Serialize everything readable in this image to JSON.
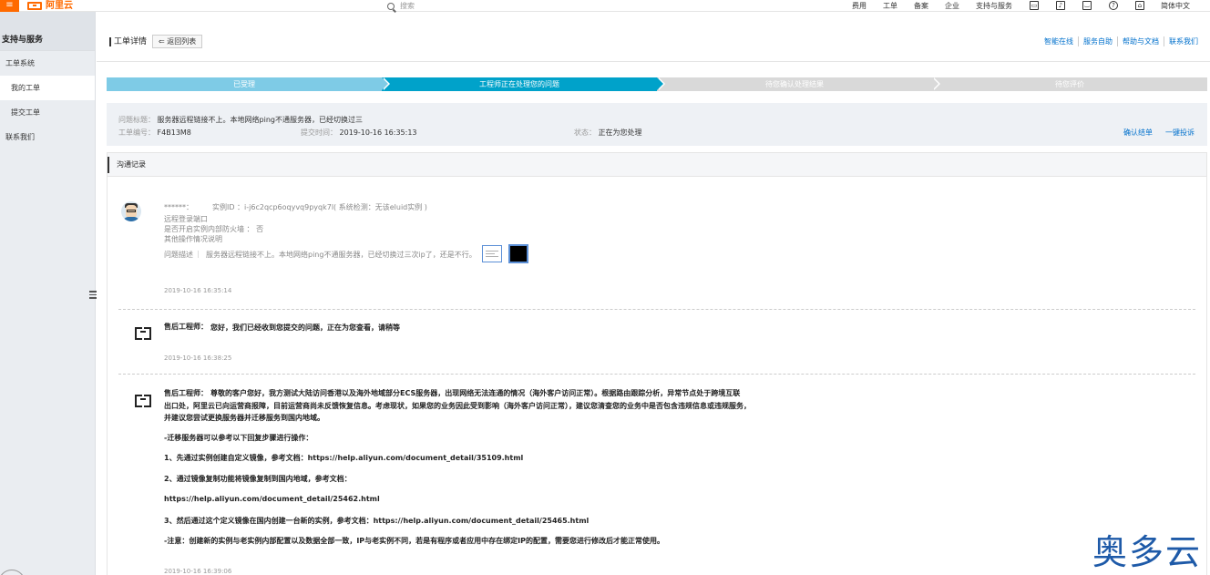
{
  "topbar": {
    "logo_text": "阿里云",
    "search_placeholder": "搜索",
    "nav": [
      "费用",
      "工单",
      "备案",
      "企业",
      "支持与服务"
    ],
    "icons": [
      "terminal-icon",
      "bell-icon",
      "cart-icon",
      "help-icon",
      "home-icon"
    ],
    "language": "简体中文",
    "accent": "#ff6a00"
  },
  "sidebar": {
    "title": "支持与服务",
    "items": [
      {
        "label": "工单系统",
        "level": 0,
        "active": false
      },
      {
        "label": "我的工单",
        "level": 1,
        "active": true
      },
      {
        "label": "提交工单",
        "level": 1,
        "active": false
      },
      {
        "label": "联系我们",
        "level": 0,
        "active": false
      }
    ]
  },
  "header": {
    "title": "工单详情",
    "back_label": "返回列表",
    "links": [
      "智能在线",
      "服务自助",
      "帮助与文档",
      "联系我们"
    ]
  },
  "steps": [
    {
      "label": "已受理",
      "state": "done"
    },
    {
      "label": "工程师正在处理您的问题",
      "state": "current"
    },
    {
      "label": "待您确认处理结果",
      "state": "todo"
    },
    {
      "label": "待您评价",
      "state": "todo"
    }
  ],
  "ticket": {
    "title_label": "问题标题：",
    "title": "服务器远程链接不上。本地网络ping不通服务器，已经切换过三",
    "id_label": "工单编号：",
    "id": "F4B13M8",
    "time_label": "提交时间：",
    "time": "2019-10-16 16:35:13",
    "status_label": "状态：",
    "status": "正在为您处理",
    "actions": [
      "确认结单",
      "一键投诉"
    ]
  },
  "comm": {
    "title": "沟通记录",
    "messages": [
      {
        "user": "******：",
        "instance": "实例ID ：i-j6c2qcp6oqyvq9pyqk7l( 系统检测：无该eluid实例 )",
        "fields": [
          "远程登录端口",
          "是否开启实例内部防火墙 ： 否",
          "其他操作情况说明"
        ],
        "desc_label": "问题描述",
        "desc": "服务器远程链接不上。本地网络ping不通服务器，已经切换过三次ip了，还是不行。",
        "time": "2019-10-16 16:35:14"
      },
      {
        "author": "售后工程师：",
        "text": "您好，我们已经收到您提交的问题，正在为您查看，请稍等",
        "time": "2019-10-16 16:38:25"
      },
      {
        "author": "售后工程师：",
        "lines": [
          "尊敬的客户您好，我方测试大陆访问香港以及海外地域部分ECS服务器，出现网络无法连通的情况（海外客户访问正常）。根据路由跟踪分析，异常节点处于跨境互联",
          "出口处，阿里云已向运营商报障，目前运营商尚未反馈恢复信息。考虑现状，如果您的业务因此受到影响（海外客户访问正常），建议您清查您的业务中是否包含违规信息或违规服务，",
          "并建议您尝试更换服务器并迁移服务到国内地域。"
        ],
        "steps_title": "-迁移服务器可以参考以下回复步骤进行操作：",
        "step1": "1、先通过实例创建自定义镜像，参考文档：https://help.aliyun.com/document_detail/35109.html",
        "step2": "2、通过镜像复制功能将镜像复制到国内地域，参考文档：",
        "step2_url": "https://help.aliyun.com/document_detail/25462.html",
        "step3": "3、然后通过这个定义镜像在国内创建一台新的实例，参考文档：https://help.aliyun.com/document_detail/25465.html",
        "note": "-注意：创建新的实例与老实例内部配置以及数据全部一致，IP与老实例不同，若是有程序或者应用中存在绑定IP的配置，需要您进行修改后才能正常使用。",
        "time": "2019-10-16 16:39:06"
      }
    ]
  },
  "watermark": "奥多云"
}
